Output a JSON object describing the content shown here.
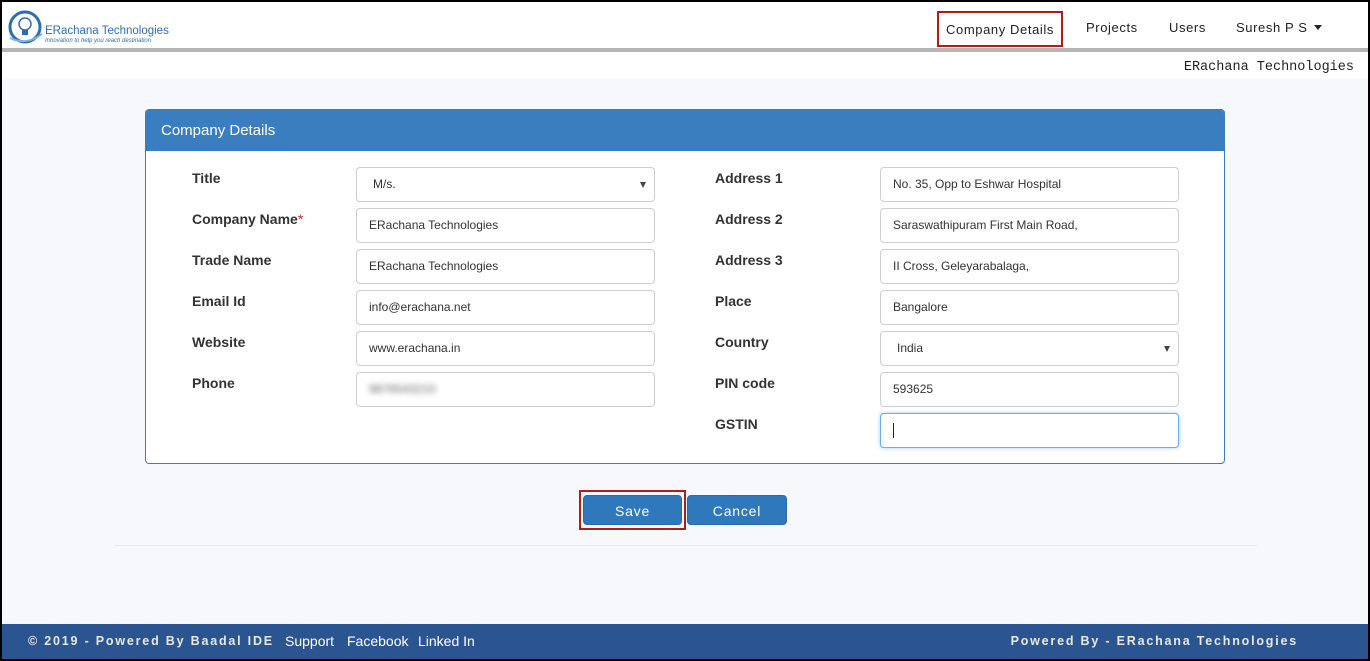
{
  "brand": {
    "name": "ERachana Technologies",
    "tagline": "Innovation to help you reach destination",
    "color": "#2c6fb1"
  },
  "nav": {
    "company_details": "Company Details",
    "projects": "Projects",
    "users": "Users",
    "user_menu": "Suresh P S"
  },
  "org_name": "ERachana Technologies",
  "panel": {
    "title": "Company Details",
    "left": {
      "title_label": "Title",
      "title_value": "M/s.",
      "company_name_label": "Company Name",
      "required_mark": "*",
      "company_name_value": "ERachana Technologies",
      "trade_name_label": "Trade Name",
      "trade_name_value": "ERachana Technologies",
      "email_label": "Email Id",
      "email_value": "info@erachana.net",
      "website_label": "Website",
      "website_value": "www.erachana.in",
      "phone_label": "Phone",
      "phone_value": "9876543210"
    },
    "right": {
      "address1_label": "Address 1",
      "address1_value": "No. 35, Opp to Eshwar Hospital",
      "address2_label": "Address 2",
      "address2_value": "Saraswathipuram First Main Road,",
      "address3_label": "Address 3",
      "address3_value": "II Cross, Geleyarabalaga,",
      "place_label": "Place",
      "place_value": "Bangalore",
      "country_label": "Country",
      "country_value": "India",
      "pin_label": "PIN code",
      "pin_value": "593625",
      "gstin_label": "GSTIN",
      "gstin_value": ""
    }
  },
  "buttons": {
    "save": "Save",
    "cancel": "Cancel"
  },
  "footer": {
    "copyright": "© 2019 - Powered By Baadal IDE",
    "support": "Support",
    "facebook": "Facebook",
    "linkedin": "Linked In",
    "powered_by": "Powered By - ERachana Technologies"
  },
  "colors": {
    "primary": "#2e78bb",
    "panel_header": "#3a7ebf",
    "footer": "#2b5590",
    "highlight": "#b11c1c"
  }
}
